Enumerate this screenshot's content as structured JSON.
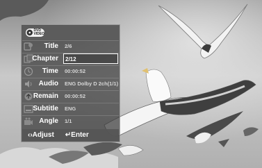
{
  "disc_badge": {
    "line1": "DVD",
    "line2": "VIDEO"
  },
  "info_rows": [
    {
      "icon": "title-icon",
      "label": "Title",
      "value": "2/6"
    },
    {
      "icon": "chapter-icon",
      "label": "Chapter",
      "value": "2/12",
      "selected": true
    },
    {
      "icon": "clock-icon",
      "label": "Time",
      "value": "00:00:52"
    },
    {
      "icon": "speaker-icon",
      "label": "Audio",
      "value": "ENG Dolby D 2ch(1/1)"
    },
    {
      "icon": "remain-icon",
      "label": "Remain",
      "value": "00:00:52"
    },
    {
      "icon": "subtitle-icon",
      "label": "Subtitle",
      "value": "ENG"
    },
    {
      "icon": "camera-icon",
      "label": "Angle",
      "value": "1/1"
    }
  ],
  "footer": {
    "adjust_label": "‹›Adjust",
    "enter_label": "↵Enter"
  },
  "colors": {
    "panel_bg": "#3a3a3a",
    "highlight_border": "#ffffff"
  }
}
